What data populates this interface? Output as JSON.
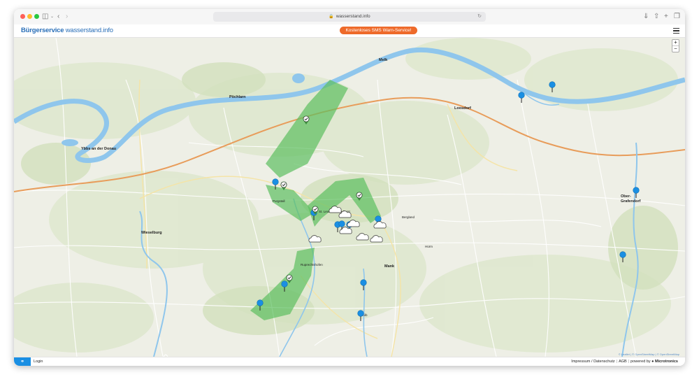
{
  "browser": {
    "url": "wasserstand.info"
  },
  "header": {
    "logo_part1": "Bürgerservice",
    "logo_part2": "wasserstand.info",
    "sms_button": "Kostenloses SMS Warn-Service!"
  },
  "map": {
    "zoom_in": "+",
    "zoom_out": "−",
    "attribution": "© Leaflet | © OpenStreetMap | © OpenStreetMap",
    "places": {
      "ybbs": "Ybbs an der Donau",
      "pochlarn": "Pöchlarn",
      "melk": "Melk",
      "loosdorf": "Loosdorf",
      "wieselburg": "Wieselburg",
      "mank": "Mank",
      "ober_grafendorf_1": "Ober-",
      "ober_grafendorf_2": "Grafendorf",
      "purgstall": "Purgstall",
      "kilb": "Kilb",
      "hurm": "Hürm",
      "bergland": "Bergland",
      "ruprechtshofen": "Ruprechtshofen",
      "st_leonhard": "St. Leonhard am Forst"
    },
    "colors": {
      "river": "#8fc6ec",
      "flood_zone": "#5cbf60",
      "marker": "#1a8fe3",
      "accent": "#ee6a2a"
    },
    "markers": {
      "gauge_count": 15,
      "ok_count": 6,
      "weather_count": 8
    }
  },
  "footer": {
    "share_icon": "share-icon",
    "login": "Login",
    "impressum": "Impressum / Datenschutz",
    "agb": "AGB",
    "powered_by": "powered by",
    "brand": "Microtronics"
  }
}
